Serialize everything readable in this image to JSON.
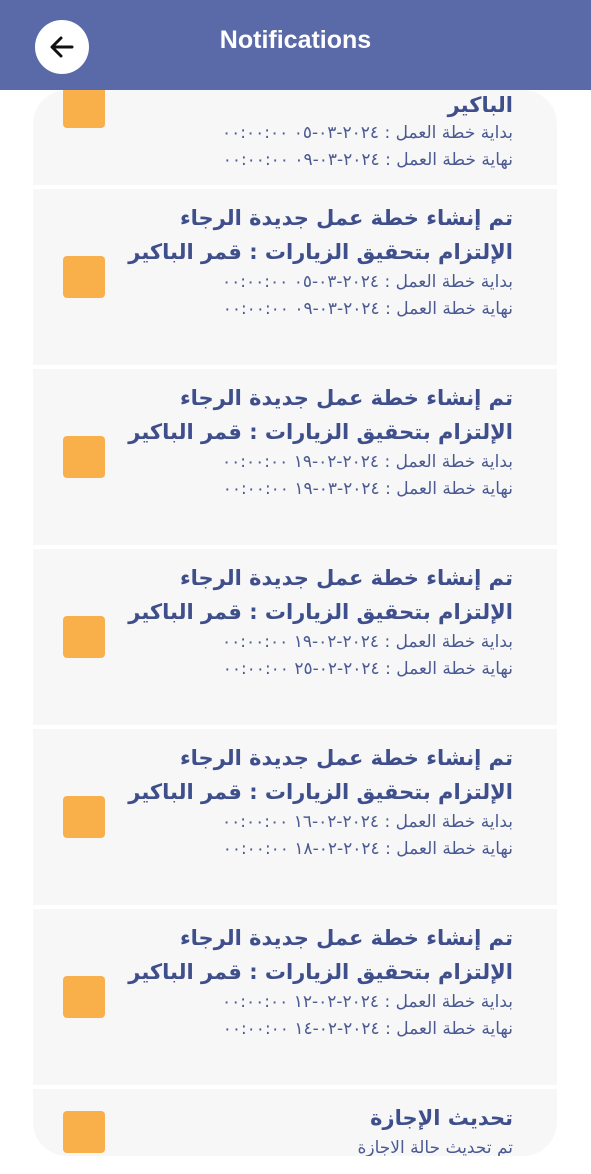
{
  "header": {
    "title": "Notifications"
  },
  "colors": {
    "appbar": "#5a6aa8",
    "accent_square": "#f9b04a",
    "text": "#3f4f8b"
  },
  "notifications": [
    {
      "title": "الباكير",
      "start": "بداية خطة العمل :  ٢٠٢٤-٠٣-٠٥ ٠٠:٠٠:٠٠",
      "end": "نهاية خطة العمل :  ٢٠٢٤-٠٣-٠٩ ٠٠:٠٠:٠٠"
    },
    {
      "title": "تم إنشاء خطة عمل جديدة الرجاء الإلتزام بتحقيق الزيارات : قمر الباكير",
      "start": "بداية خطة العمل :  ٢٠٢٤-٠٣-٠٥ ٠٠:٠٠:٠٠",
      "end": "نهاية خطة العمل :  ٢٠٢٤-٠٣-٠٩ ٠٠:٠٠:٠٠"
    },
    {
      "title": "تم إنشاء خطة عمل جديدة الرجاء الإلتزام بتحقيق الزيارات : قمر الباكير",
      "start": "بداية خطة العمل :  ٢٠٢٤-٠٢-١٩ ٠٠:٠٠:٠٠",
      "end": "نهاية خطة العمل :  ٢٠٢٤-٠٣-١٩ ٠٠:٠٠:٠٠"
    },
    {
      "title": "تم إنشاء خطة عمل جديدة الرجاء الإلتزام بتحقيق الزيارات : قمر الباكير",
      "start": "بداية خطة العمل :  ٢٠٢٤-٠٢-١٩ ٠٠:٠٠:٠٠",
      "end": "نهاية خطة العمل :  ٢٠٢٤-٠٢-٢٥ ٠٠:٠٠:٠٠"
    },
    {
      "title": "تم إنشاء خطة عمل جديدة الرجاء الإلتزام بتحقيق الزيارات : قمر الباكير",
      "start": "بداية خطة العمل :  ٢٠٢٤-٠٢-١٦ ٠٠:٠٠:٠٠",
      "end": "نهاية خطة العمل :  ٢٠٢٤-٠٢-١٨ ٠٠:٠٠:٠٠"
    },
    {
      "title": "تم إنشاء خطة عمل جديدة الرجاء الإلتزام بتحقيق الزيارات : قمر الباكير",
      "start": "بداية خطة العمل :  ٢٠٢٤-٠٢-١٢ ٠٠:٠٠:٠٠",
      "end": "نهاية خطة العمل :  ٢٠٢٤-٠٢-١٤ ٠٠:٠٠:٠٠"
    },
    {
      "title": "تحديث الإجازة",
      "body": "تم تحديث حالة الاجازة"
    }
  ]
}
